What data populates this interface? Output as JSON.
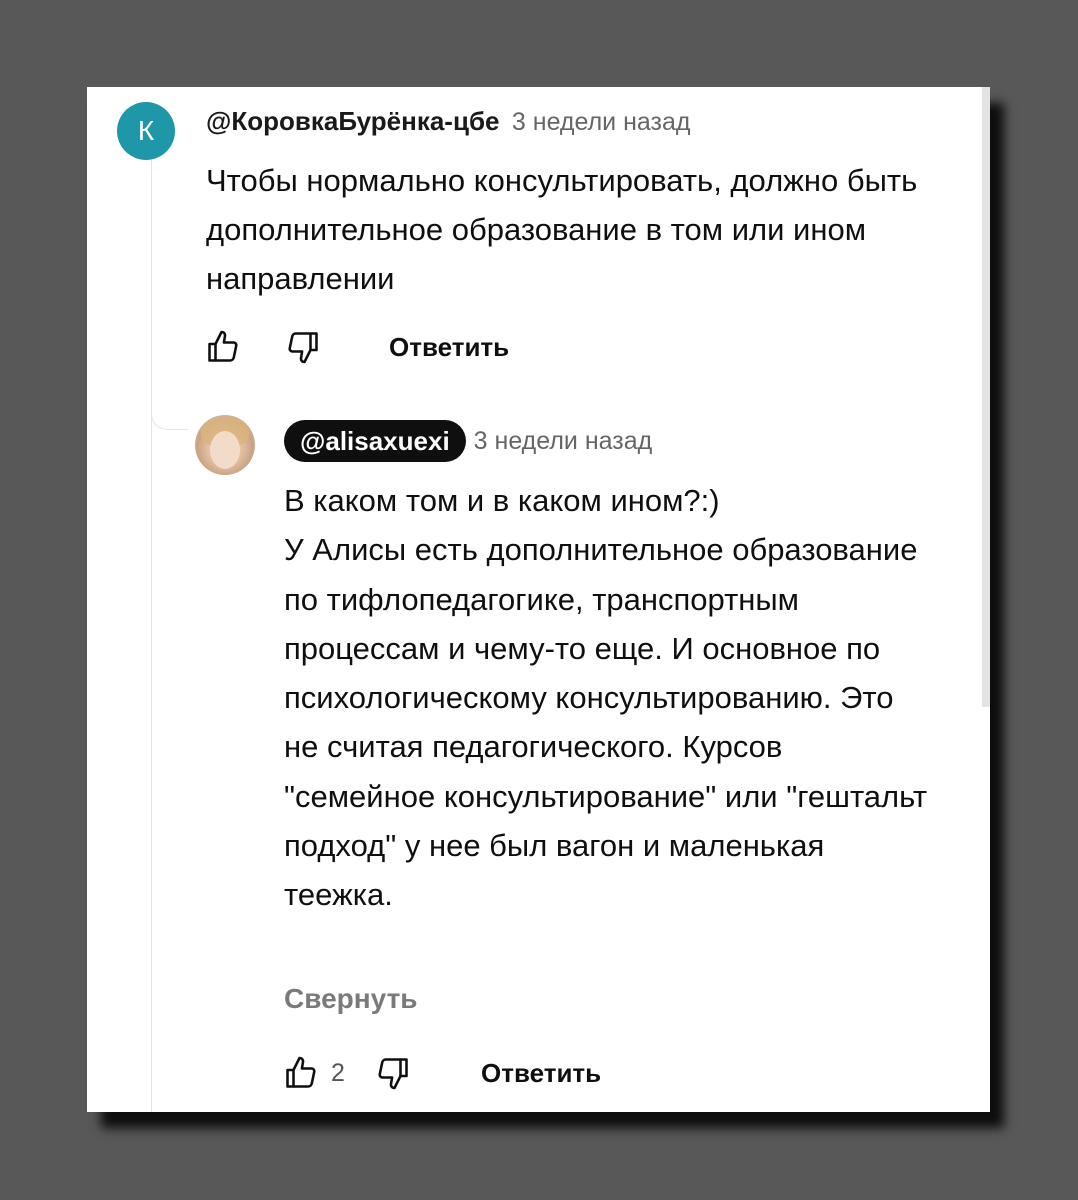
{
  "comment": {
    "avatar_letter": "К",
    "avatar_color": "#1e97a8",
    "author": "@КоровкаБурёнка-цбе",
    "time": "3 недели назад",
    "text": "Чтобы нормально консультировать, должно быть дополнительное образование в том или ином направлении",
    "like_icon": "thumb-up-icon",
    "dislike_icon": "thumb-down-icon",
    "reply_label": "Ответить"
  },
  "reply": {
    "author": "@alisaxuexi",
    "time": "3 недели назад",
    "text": "В каком том и  в каком ином?:)\nУ Алисы есть дополнительное образование по тифлопедагогике, транспортным процессам и чему-то еще. И основное по психологическому консультированию. Это не считая педагогического. Курсов \"семейное консультирование\" или \"гештальт подход\" у нее был вагон и маленькая теежка.",
    "collapse_label": "Свернуть",
    "likes": "2",
    "like_icon": "thumb-up-icon",
    "dislike_icon": "thumb-down-icon",
    "reply_label": "Ответить"
  }
}
